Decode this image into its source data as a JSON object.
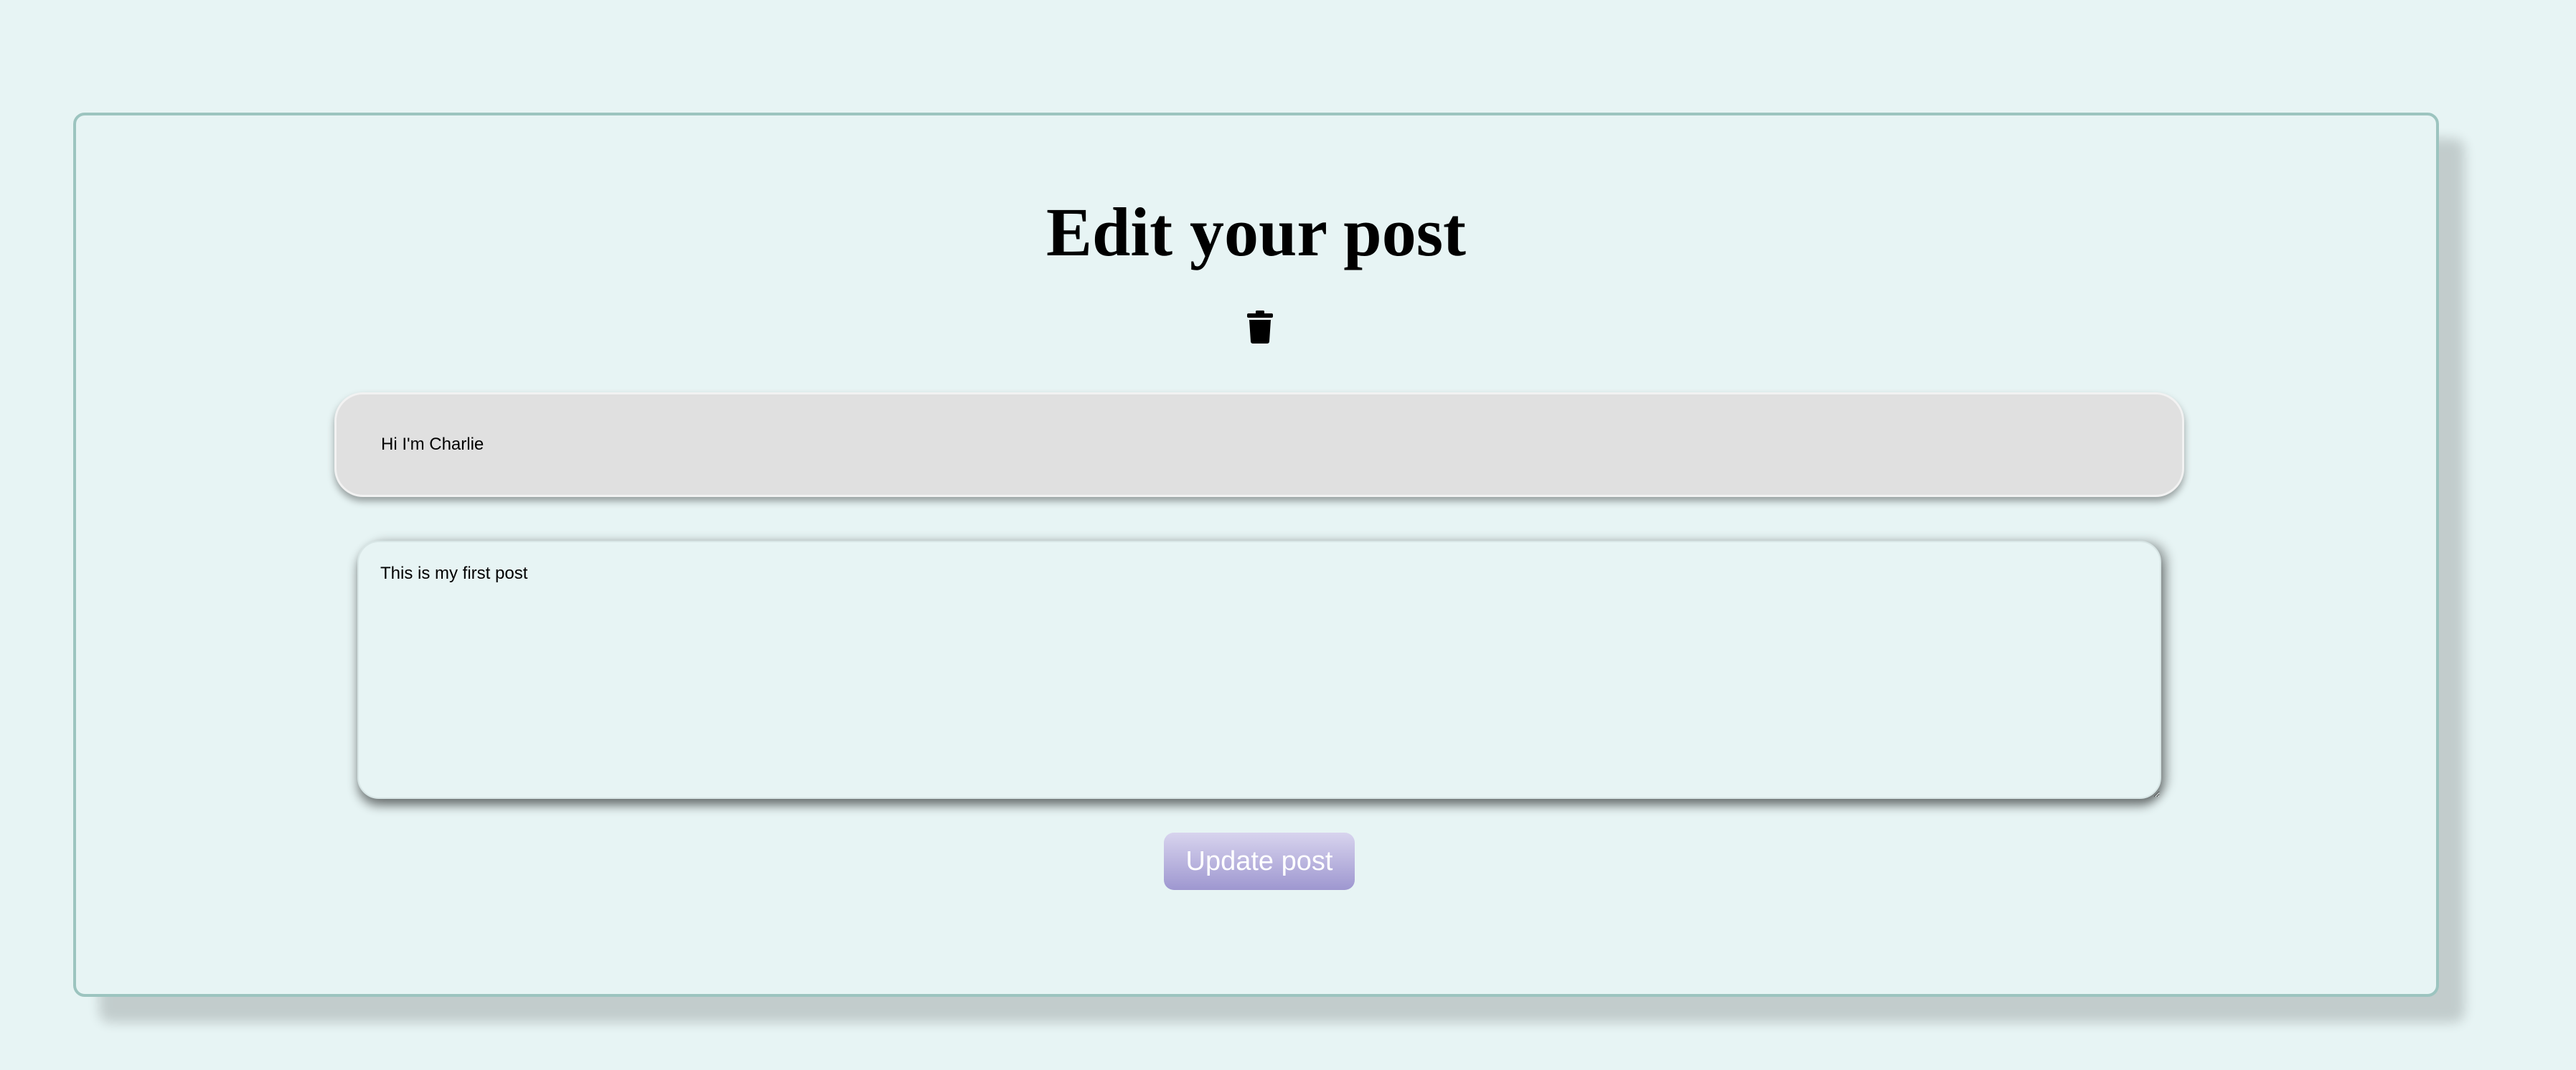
{
  "page": {
    "title": "Edit your post"
  },
  "form": {
    "title_value": "Hi I'm Charlie",
    "body_value": "This is my first post",
    "submit_label": "Update post"
  },
  "icons": {
    "delete": "trash-icon"
  },
  "colors": {
    "background": "#e7f4f4",
    "card_border": "#9cc4bf",
    "title_field": "#e0e0e0",
    "button_top": "#d8d4ee",
    "button_bottom": "#9e97d0"
  }
}
